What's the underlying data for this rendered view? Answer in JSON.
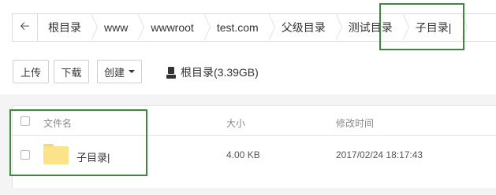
{
  "breadcrumb": {
    "items": [
      "根目录",
      "www",
      "wwwroot",
      "test.com",
      "父级目录",
      "测试目录",
      "子目录|"
    ]
  },
  "toolbar": {
    "upload_label": "上传",
    "download_label": "下载",
    "create_label": "创建",
    "disk_label": "根目录(3.39GB)"
  },
  "table": {
    "headers": {
      "name": "文件名",
      "size": "大小",
      "modified": "修改时间"
    },
    "rows": [
      {
        "name": "子目录|",
        "size": "4.00 KB",
        "modified": "2017/02/24 18:17:43",
        "icon": "folder-icon"
      }
    ]
  },
  "colors": {
    "highlight": "#3b8a3b",
    "folder": "#fce38a"
  }
}
